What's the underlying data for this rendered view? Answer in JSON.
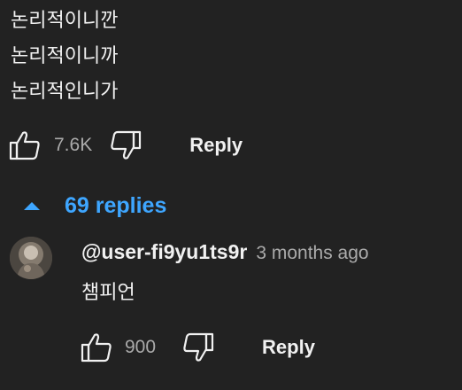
{
  "comment": {
    "lines": [
      "논리적이니깐",
      "논리적이니까",
      "논리적인니가"
    ],
    "like_count": "7.6K",
    "reply_label": "Reply"
  },
  "replies_toggle": {
    "label": "69 replies",
    "icon": "caret-up-icon"
  },
  "reply": {
    "author": "@user-fi9yu1ts9r",
    "time": "3 months ago",
    "text": "챔피언",
    "like_count": "900",
    "reply_label": "Reply"
  },
  "icons": {
    "like": "thumbs-up-icon",
    "dislike": "thumbs-down-icon"
  },
  "colors": {
    "background": "#222222",
    "text": "#f1f1f1",
    "secondary_text": "#aaaaaa",
    "accent": "#3ea6ff"
  }
}
